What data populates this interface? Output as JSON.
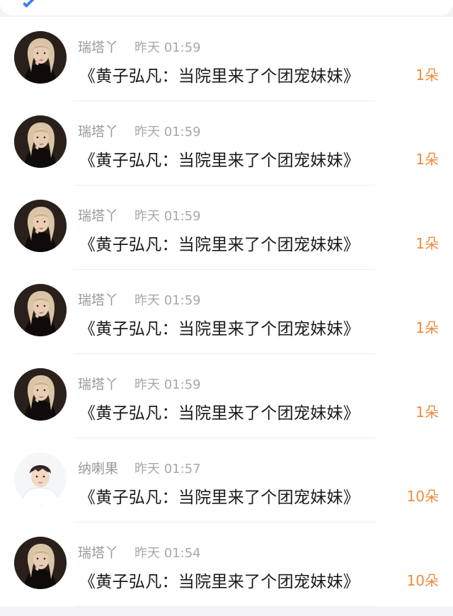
{
  "items": [
    {
      "name": "瑞塔丫",
      "time": "昨天 01:59",
      "text": "《黄子弘凡：当院里来了个团宠妹妹》",
      "count": "1朵",
      "avatar_icon": "woman-avatar-icon"
    },
    {
      "name": "瑞塔丫",
      "time": "昨天 01:59",
      "text": "《黄子弘凡：当院里来了个团宠妹妹》",
      "count": "1朵",
      "avatar_icon": "woman-avatar-icon"
    },
    {
      "name": "瑞塔丫",
      "time": "昨天 01:59",
      "text": "《黄子弘凡：当院里来了个团宠妹妹》",
      "count": "1朵",
      "avatar_icon": "woman-avatar-icon"
    },
    {
      "name": "瑞塔丫",
      "time": "昨天 01:59",
      "text": "《黄子弘凡：当院里来了个团宠妹妹》",
      "count": "1朵",
      "avatar_icon": "woman-avatar-icon"
    },
    {
      "name": "瑞塔丫",
      "time": "昨天 01:59",
      "text": "《黄子弘凡：当院里来了个团宠妹妹》",
      "count": "1朵",
      "avatar_icon": "woman-avatar-icon"
    },
    {
      "name": "纳喇果",
      "time": "昨天 01:57",
      "text": "《黄子弘凡：当院里来了个团宠妹妹》",
      "count": "10朵",
      "avatar_icon": "boy-avatar-icon"
    },
    {
      "name": "瑞塔丫",
      "time": "昨天 01:54",
      "text": "《黄子弘凡：当院里来了个团宠妹妹》",
      "count": "10朵",
      "avatar_icon": "woman-avatar-icon"
    }
  ],
  "colors": {
    "count": "#f08a3c",
    "name": "#9a9a9a",
    "text": "#1b1b1b",
    "background": "#f3f3f5"
  }
}
